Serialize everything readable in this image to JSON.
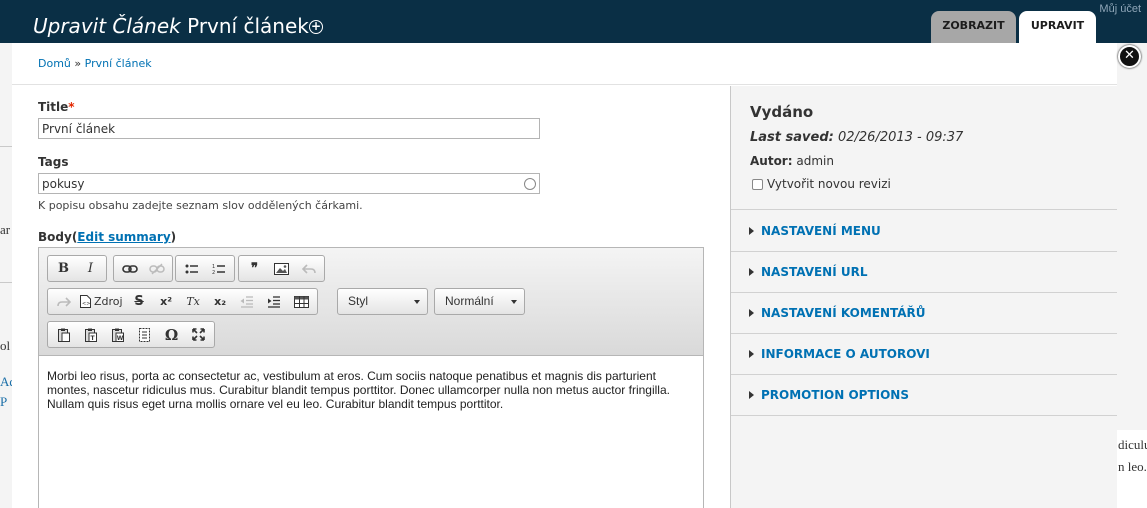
{
  "background": {
    "account_link": "Můj účet",
    "fragments": [
      "ar",
      "ol",
      "Ad",
      "P",
      "diculu",
      "n leo."
    ]
  },
  "header": {
    "title_type": "Upravit Článek",
    "title_name": "První článek",
    "shortcut_icon": "plus-circle-icon",
    "tabs": [
      {
        "label": "Zobrazit",
        "active": false
      },
      {
        "label": "Upravit",
        "active": true
      }
    ],
    "close_icon": "close-icon"
  },
  "breadcrumb": {
    "items": [
      "Domů",
      "První článek"
    ],
    "separator": "»"
  },
  "form": {
    "title_label": "Title",
    "title_required_marker": "*",
    "title_value": "První článek",
    "tags_label": "Tags",
    "tags_value": "pokusy",
    "tags_description": "K popisu obsahu zadejte seznam slov oddělených čárkami.",
    "body_label": "Body",
    "body_edit_summary": "Edit summary",
    "body_paren_open": "(",
    "body_paren_close": ")"
  },
  "editor": {
    "toolbar": {
      "bold": "B",
      "italic": "I",
      "source": "Zdroj",
      "strike": "S",
      "superscript": "x²",
      "remove_format": "Tx",
      "subscript": "x₂",
      "quote": "❞",
      "omega": "Ω",
      "style_combo": "Styl",
      "format_combo": "Normální"
    },
    "content": "Morbi leo risus, porta ac consectetur ac, vestibulum at eros. Cum sociis natoque penatibus et magnis dis parturient montes, nascetur ridiculus mus. Curabitur blandit tempus porttitor. Donec ullamcorper nulla non metus auctor fringilla. Nullam quis risus eget urna mollis ornare vel eu leo. Curabitur blandit tempus porttitor."
  },
  "sidebar": {
    "status_title": "Vydáno",
    "last_saved_label": "Last saved:",
    "last_saved_value": "02/26/2013 - 09:37",
    "author_label": "Autor:",
    "author_value": "admin",
    "new_revision_label": "Vytvořit novou revizi",
    "new_revision_checked": false,
    "sections": [
      "Nastavení menu",
      "Nastavení URL",
      "Nastavení komentářů",
      "Informace o autorovi",
      "Promotion options"
    ]
  },
  "colors": {
    "header_bg": "#0a2f45",
    "link": "#0071b3",
    "required": "#e32700",
    "sidebar_bg": "#f4f4f4"
  }
}
